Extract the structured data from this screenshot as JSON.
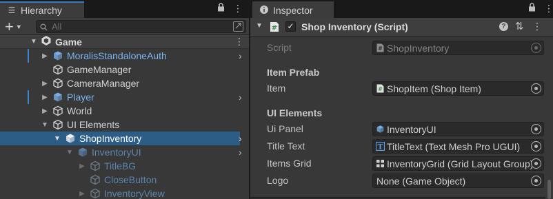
{
  "hierarchy": {
    "tab_label": "Hierarchy",
    "search_placeholder": "All",
    "scene": {
      "label": "Game"
    },
    "rows": [
      {
        "label": "MoralisStandaloneAuth"
      },
      {
        "label": "GameManager"
      },
      {
        "label": "CameraManager"
      },
      {
        "label": "Player"
      },
      {
        "label": "World"
      },
      {
        "label": "UI Elements"
      },
      {
        "label": "ShopInventory"
      },
      {
        "label": "InventoryUI"
      },
      {
        "label": "TitleBG"
      },
      {
        "label": "CloseButton"
      },
      {
        "label": "InventoryView"
      }
    ]
  },
  "inspector": {
    "tab_label": "Inspector",
    "component": {
      "title": "Shop Inventory (Script)",
      "enabled": true
    },
    "script": {
      "label": "Script",
      "value": "ShopInventory"
    },
    "item_prefab": {
      "header": "Item Prefab",
      "item": {
        "label": "Item",
        "value": "ShopItem (Shop Item)"
      }
    },
    "ui_elements": {
      "header": "UI Elements",
      "ui_panel": {
        "label": "Ui Panel",
        "value": "InventoryUI"
      },
      "title_text": {
        "label": "Title Text",
        "value": "TitleText (Text Mesh Pro UGUI)"
      },
      "items_grid": {
        "label": "Items Grid",
        "value": "InventoryGrid (Grid Layout Group)"
      },
      "logo": {
        "label": "Logo",
        "value": "None (Game Object)"
      }
    }
  },
  "colors": {
    "panel_bg": "#383838",
    "selection": "#2c5d87",
    "prefab_text": "#7cb4ef",
    "inactive_prefab_text": "#5c84ab",
    "tab_accent": "#3a79bb"
  }
}
